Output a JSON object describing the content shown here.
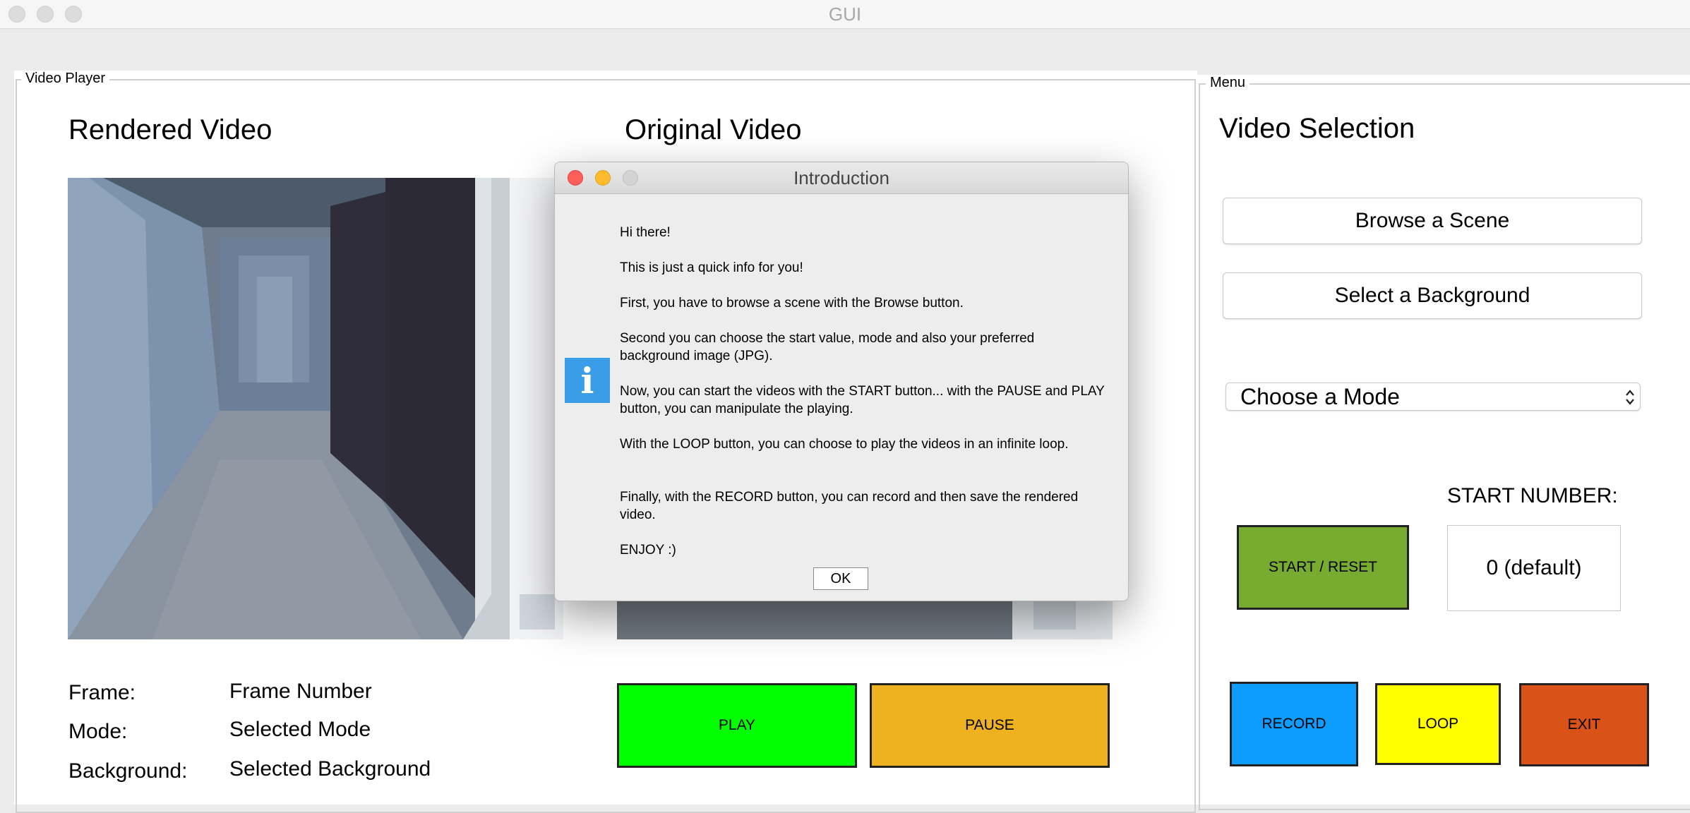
{
  "window": {
    "title": "GUI"
  },
  "video_player": {
    "group_label": "Video Player",
    "rendered_title": "Rendered Video",
    "original_title": "Original Video",
    "info": [
      {
        "label": "Frame:",
        "value": "Frame Number"
      },
      {
        "label": "Mode:",
        "value": "Selected Mode"
      },
      {
        "label": "Background:",
        "value": "Selected Background"
      }
    ],
    "play_label": "PLAY",
    "pause_label": "PAUSE"
  },
  "menu": {
    "group_label": "Menu",
    "title": "Video Selection",
    "browse_label": "Browse a Scene",
    "background_label": "Select a Background",
    "mode_select": {
      "selected": "Choose a Mode"
    },
    "start_number_label": "START NUMBER:",
    "start_number_value": "0 (default)",
    "start_reset_label": "START / RESET",
    "record_label": "RECORD",
    "loop_label": "LOOP",
    "exit_label": "EXIT"
  },
  "dialog": {
    "title": "Introduction",
    "paragraphs": [
      "Hi there!",
      "This is just a quick info for you!",
      "First, you have to browse a scene with the Browse button.",
      "Second you can choose the start value, mode and also your preferred background image (JPG).",
      "Now, you can start the videos with the START button... with the PAUSE and PLAY button, you can manipulate the playing.",
      "With the LOOP button, you can choose to play the videos in an infinite loop.",
      "Finally, with the RECORD button, you can record and then save the rendered video.",
      "ENJOY :)"
    ],
    "ok_label": "OK"
  },
  "colors": {
    "play": "#00ff00",
    "pause": "#eeb120",
    "start_reset": "#77ac30",
    "record": "#0d9cff",
    "loop": "#ffff00",
    "exit": "#d95218",
    "info_icon": "#3a9de8"
  },
  "icons": [
    "close-dot-icon",
    "minimize-dot-icon",
    "zoom-dot-icon",
    "info-icon",
    "select-chevron-icon"
  ]
}
